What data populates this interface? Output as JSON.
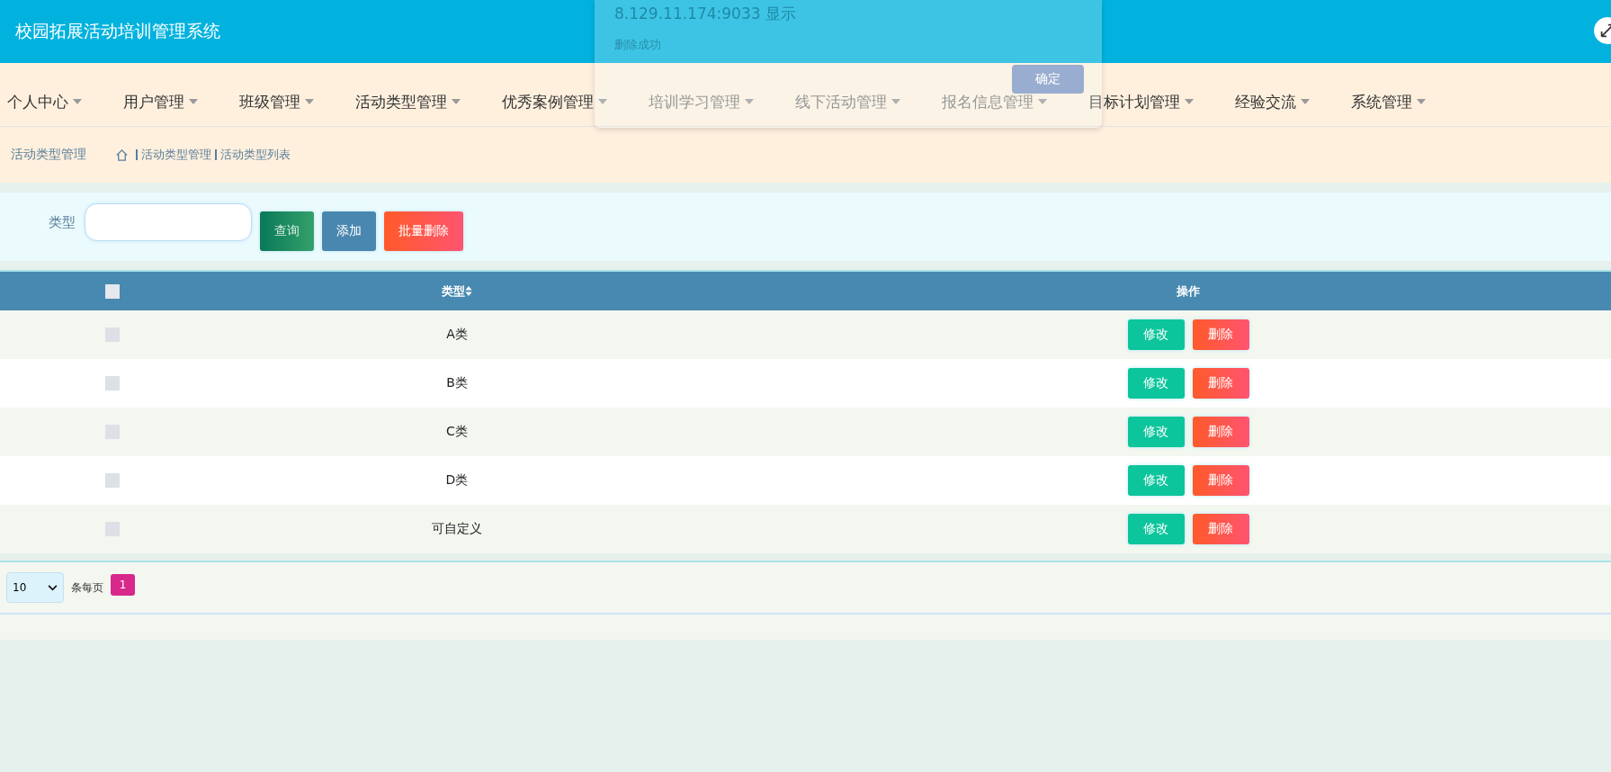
{
  "header": {
    "title": "校园拓展活动培训管理系统"
  },
  "nav": [
    {
      "label": "个人中心"
    },
    {
      "label": "用户管理"
    },
    {
      "label": "班级管理"
    },
    {
      "label": "活动类型管理"
    },
    {
      "label": "优秀案例管理"
    },
    {
      "label": "培训学习管理"
    },
    {
      "label": "线下活动管理"
    },
    {
      "label": "报名信息管理"
    },
    {
      "label": "目标计划管理"
    },
    {
      "label": "经验交流"
    },
    {
      "label": "系统管理"
    }
  ],
  "breadcrumb": {
    "page_title": "活动类型管理",
    "path": [
      "活动类型管理",
      "活动类型列表"
    ]
  },
  "search": {
    "label": "类型",
    "buttons": [
      {
        "label": "查询",
        "kind": "search"
      },
      {
        "label": "添加",
        "kind": "add"
      },
      {
        "label": "批量删除",
        "kind": "delete"
      }
    ]
  },
  "table": {
    "columns": [
      "类型",
      "操作"
    ],
    "header_checked": false,
    "rows": [
      {
        "type": "A类",
        "checked": false,
        "actions": [
          "修改",
          "删除"
        ]
      },
      {
        "type": "B类",
        "checked": false,
        "actions": [
          "修改",
          "删除"
        ]
      },
      {
        "type": "C类",
        "checked": false,
        "actions": [
          "修改",
          "删除"
        ]
      },
      {
        "type": "D类",
        "checked": false,
        "actions": [
          "修改",
          "删除"
        ]
      },
      {
        "type": "可自定义",
        "checked": false,
        "actions": [
          "修改",
          "删除"
        ]
      }
    ]
  },
  "pagination": {
    "page_size": "10",
    "per_page_label": "条每页",
    "pages": [
      {
        "label": "1",
        "selected": true
      }
    ]
  },
  "alert": {
    "title": "8.129.11.174:9033 显示",
    "message": "删除成功",
    "button": "确定"
  }
}
